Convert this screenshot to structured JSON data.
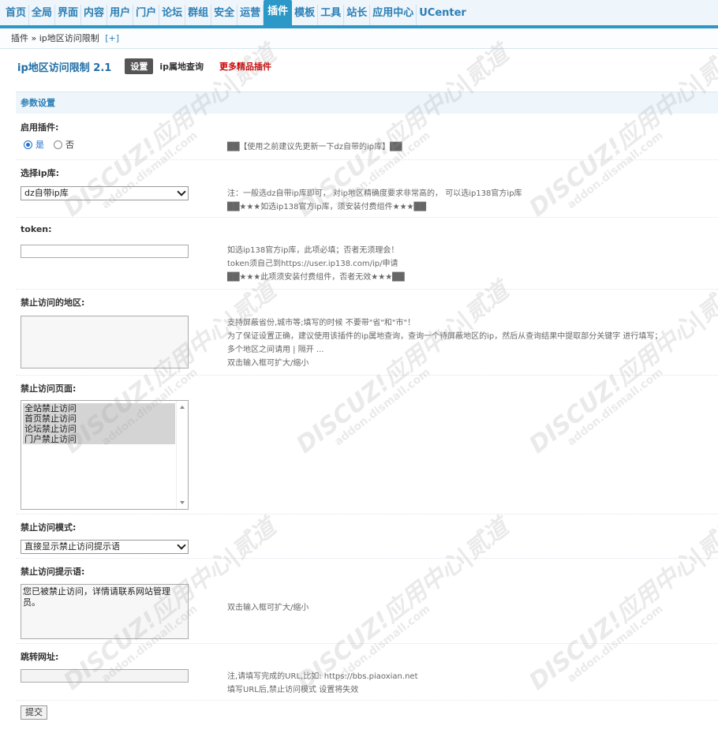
{
  "nav": {
    "items": [
      "首页",
      "全局",
      "界面",
      "内容",
      "用户",
      "门户",
      "论坛",
      "群组",
      "安全",
      "运营",
      "插件",
      "模板",
      "工具",
      "站长",
      "应用中心",
      "UCenter"
    ],
    "active_index": 10
  },
  "breadcrumb": {
    "path": "插件 » ip地区访问限制",
    "add": "[+]"
  },
  "header": {
    "title": "ip地区访问限制 2.1",
    "tab_settings": "设置",
    "tab_iplookup": "ip属地查询",
    "more_plugins": "更多精品插件"
  },
  "section": {
    "title": "参数设置"
  },
  "fields": {
    "enable": {
      "label": "启用插件:",
      "yes": "是",
      "no": "否",
      "hint": "██【使用之前建议先更新一下dz自带的ip库】██"
    },
    "iplib": {
      "label": "选择ip库:",
      "value": "dz自带ip库",
      "hint1": "注：一般选dz自带ip库即可， 对ip地区精确度要求非常高的， 可以选ip138官方ip库",
      "hint2": "██★★★如选ip138官方ip库，须安装付费组件★★★██"
    },
    "token": {
      "label": "token:",
      "hint1": "如选ip138官方ip库，此项必填；否者无须理会！",
      "hint2": "token须自己到https://user.ip138.com/ip/申请",
      "hint3": "██★★★此项须安装付费组件，否者无效★★★██"
    },
    "regions": {
      "label": "禁止访问的地区:",
      "hint1": "支持屏蔽省份,城市等;填写的时候 不要带\"省\"和\"市\"！",
      "hint2": "为了保证设置正确，建议使用该插件的ip属地查询，查询一个待屏蔽地区的ip，然后从查询结果中提取部分关键字 进行填写；",
      "hint3": "多个地区之间请用 | 隔开 ...",
      "hint4": "双击输入框可扩大/缩小"
    },
    "pages": {
      "label": "禁止访问页面:",
      "options": [
        "全站禁止访问",
        "首页禁止访问",
        "论坛禁止访问",
        "门户禁止访问"
      ]
    },
    "mode": {
      "label": "禁止访问模式:",
      "value": "直接显示禁止访问提示语"
    },
    "message": {
      "label": "禁止访问提示语:",
      "value": "您已被禁止访问，详情请联系网站管理员。",
      "hint": "双击输入框可扩大/缩小"
    },
    "redirect": {
      "label": "跳转网址:",
      "hint1": "注,请填写完成的URL,比如: https://bbs.piaoxian.net",
      "hint2": "填写URL后,禁止访问模式 设置将失效"
    }
  },
  "submit_label": "提交",
  "watermark": {
    "line1": "DISCUZ!应用中心|贰道",
    "line2": "addon.dismall.com"
  }
}
